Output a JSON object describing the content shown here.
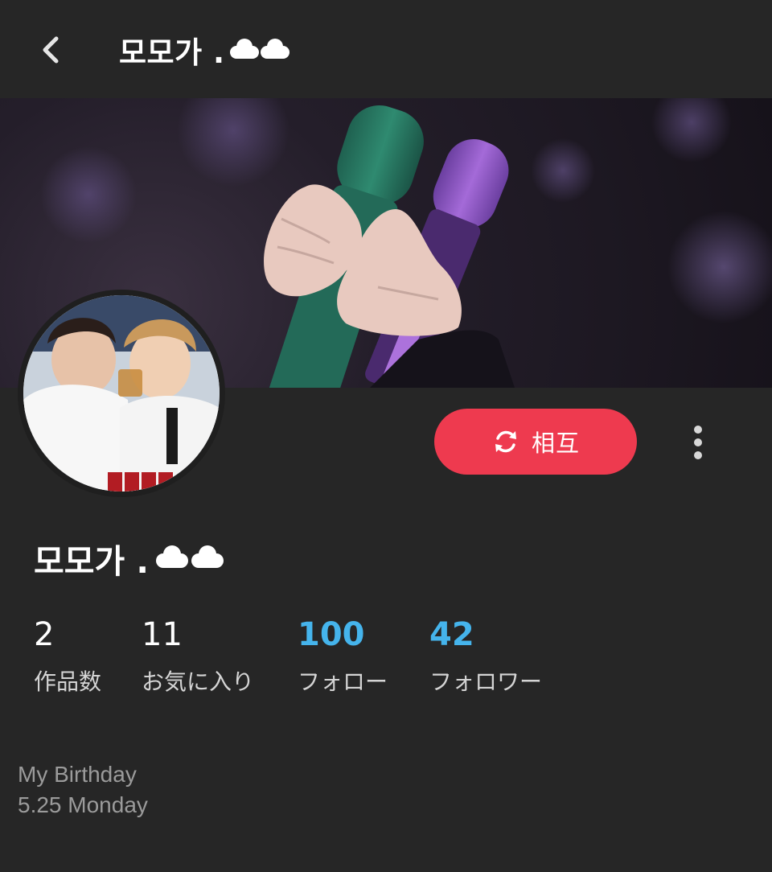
{
  "header": {
    "title": "모모가 .",
    "back_icon": "chevron-left-icon"
  },
  "banner": {
    "image": "stage-microphones-photo"
  },
  "avatar": {
    "image": "two-people-drinking-photo"
  },
  "actions": {
    "mutual_label": "相互",
    "mutual_icon": "sync-icon",
    "more_icon": "more-vertical-icon",
    "accent_color": "#ee3a4f"
  },
  "profile": {
    "name": "모모가 .",
    "name_decoration": "cloud-icons"
  },
  "stats": [
    {
      "value": "2",
      "label": "作品数",
      "highlight": false
    },
    {
      "value": "11",
      "label": "お気に入り",
      "highlight": false
    },
    {
      "value": "100",
      "label": "フォロー",
      "highlight": true
    },
    {
      "value": "42",
      "label": "フォロワー",
      "highlight": true
    }
  ],
  "bio": {
    "line1": "My Birthday",
    "line2": "5.25 Monday"
  },
  "colors": {
    "background": "#262626",
    "link_blue": "#45b4ec"
  }
}
